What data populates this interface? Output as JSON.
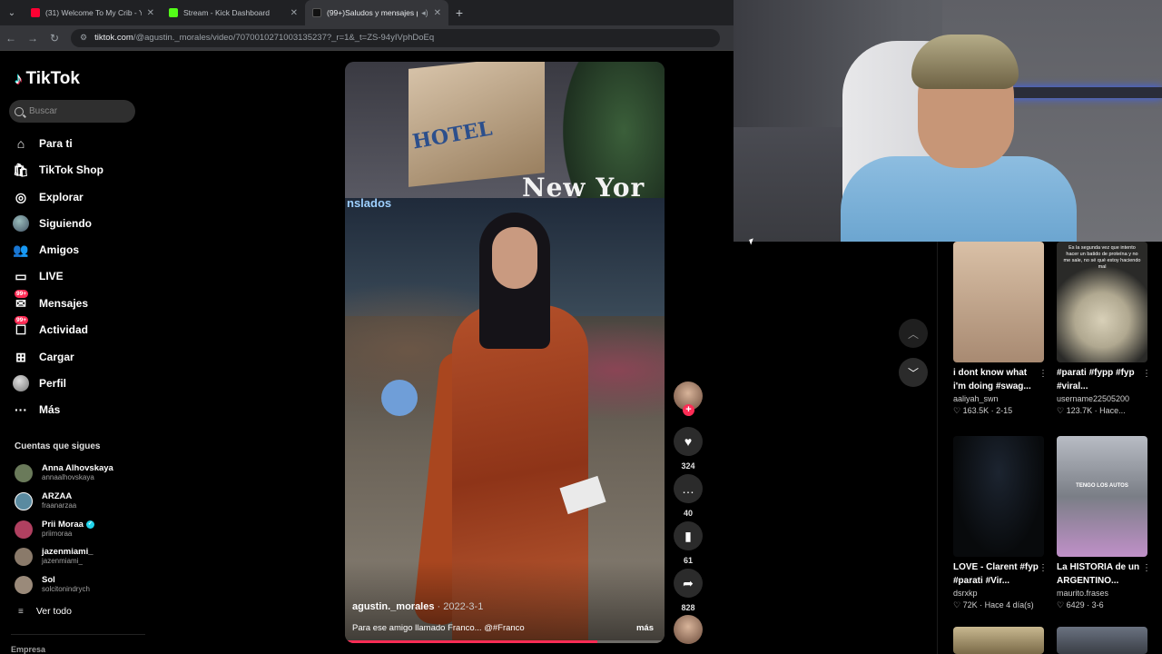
{
  "browser": {
    "tabs": [
      {
        "title": "(31) Welcome To My Crib - You",
        "favicon_color": "#ff0033",
        "active": false
      },
      {
        "title": "Stream - Kick Dashboard",
        "favicon_color": "#53fc18",
        "active": false
      },
      {
        "title": "(99+)Saludos y mensajes p",
        "favicon_color": "#111111",
        "active": true
      }
    ],
    "url_host": "tiktok.com",
    "url_path": "/@agustin._morales/video/7070010271003135237?_r=1&_t=ZS-94yIVphDoEq"
  },
  "sidebar": {
    "logo": "TikTok",
    "search_placeholder": "Buscar",
    "nav": [
      {
        "label": "Para ti",
        "icon": "home-icon"
      },
      {
        "label": "TikTok Shop",
        "icon": "shop-icon"
      },
      {
        "label": "Explorar",
        "icon": "compass-icon"
      },
      {
        "label": "Siguiendo",
        "icon": "following-avatar-icon"
      },
      {
        "label": "Amigos",
        "icon": "friends-icon"
      },
      {
        "label": "LIVE",
        "icon": "live-icon"
      },
      {
        "label": "Mensajes",
        "icon": "messages-icon",
        "badge": "99+"
      },
      {
        "label": "Actividad",
        "icon": "activity-icon",
        "badge": "99+"
      },
      {
        "label": "Cargar",
        "icon": "upload-icon"
      },
      {
        "label": "Perfil",
        "icon": "profile-avatar-icon"
      },
      {
        "label": "Más",
        "icon": "more-icon"
      }
    ],
    "following_title": "Cuentas que sigues",
    "accounts": [
      {
        "name": "Anna Alhovskaya",
        "handle": "annaalhovskaya",
        "color": "#6a7a5a"
      },
      {
        "name": "ARZAA",
        "handle": "fraanarzaa",
        "color": "#5a8aa0"
      },
      {
        "name": "Prii Moraa",
        "handle": "priimoraa",
        "color": "#b04060",
        "verified": true
      },
      {
        "name": "jazenmiami_",
        "handle": "jazenmiami_",
        "color": "#8a7a6a"
      },
      {
        "name": "Sol",
        "handle": "solcitonindrych",
        "color": "#9a8a7a"
      }
    ],
    "see_all": "Ver todo",
    "footer_label": "Empresa"
  },
  "video": {
    "author": "agustin._morales",
    "date": "2022-3-1",
    "caption": "Para ese amigo llamado Franco... @#Franco",
    "more": "más",
    "progress": 0.79,
    "scene_text": {
      "billboard": "HOTEL",
      "sign": "New Yor",
      "store": "nslados"
    },
    "actions": {
      "likes": "324",
      "comments": "40",
      "saves": "61",
      "shares": "828"
    }
  },
  "feed": [
    {
      "title": "i dont know what i'm doing #swag...",
      "user": "aaliyah_swn",
      "likes": "163.5K",
      "when": "2-15",
      "thumb": "#c9a98e"
    },
    {
      "title": "#parati #fypp #fyp #viral...",
      "user": "username22505200",
      "likes": "123.7K",
      "when": "Hace...",
      "thumb": "#3a3a36"
    },
    {
      "title": "LOVE - Clarent #fyp #parati #Vir...",
      "user": "dsrxkp",
      "likes": "72K",
      "when": "Hace 4 día(s)",
      "thumb": "#101418"
    },
    {
      "title": "La HISTORIA de un ARGENTINO...",
      "user": "maurito.frases",
      "likes": "6429",
      "when": "3-6",
      "thumb": "#8a8c92"
    }
  ],
  "thumb_overlay_texts": [
    "Es la segunda vez que intento hacer un batido de proteína y no me sale, no sé qué estoy haciendo mal",
    "TENGO LOS AUTOS"
  ]
}
